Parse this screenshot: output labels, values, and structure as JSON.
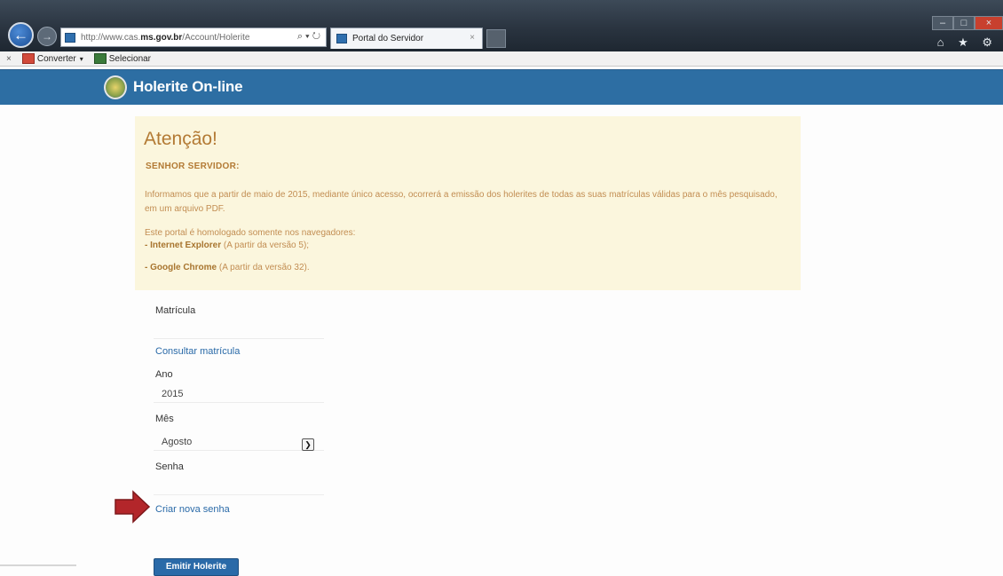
{
  "browser": {
    "url_prefix": "http://www.cas.",
    "url_domain": "ms.gov.br",
    "url_path": "/Account/Holerite",
    "url_tools": "⌕ ▾ ↻",
    "tab_title": "Portal do Servidor",
    "tab_close": "×",
    "back_glyph": "←",
    "forward_glyph": "→",
    "window_buttons": [
      "–",
      "□",
      "×"
    ],
    "toolbar_icons": "⌂ ★ ⚙"
  },
  "command_bar": {
    "close_glyph": "×",
    "convert_label": "Converter",
    "convert_caret": "▾",
    "select_label": "Selecionar"
  },
  "header": {
    "title": "Holerite On-line"
  },
  "alert": {
    "title": "Atenção!",
    "subtitle": "SENHOR SERVIDOR:",
    "paragraph1": "Informamos que a partir de maio de 2015, mediante único acesso, ocorrerá a emissão dos holerites de todas as suas matrículas válidas para o mês pesquisado, em um arquivo PDF.",
    "paragraph2": "Este portal é homologado somente nos navegadores:",
    "browser1_name": "- Internet Explorer",
    "browser1_note": " (A partir da versão 5);",
    "browser2_name": "- Google Chrome",
    "browser2_note": " (A partir da versão 32)."
  },
  "form": {
    "matricula_label": "Matrícula",
    "consultar_link": "Consultar matrícula",
    "ano_label": "Ano",
    "ano_value": "2015",
    "mes_label": "Mês",
    "mes_value": "Agosto",
    "senha_label": "Senha",
    "criar_senha_link": "Criar nova senha",
    "emitir_button": "Emitir Holerite"
  },
  "colors": {
    "header_bg": "#2d6ea3",
    "alert_bg": "#fbf6dd",
    "alert_title": "#b37a34",
    "link": "#2a6aa8",
    "arrow": "#b3262a"
  }
}
